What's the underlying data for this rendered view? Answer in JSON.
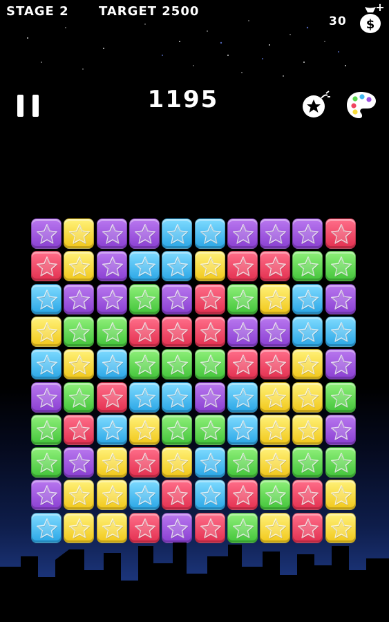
{
  "hud": {
    "stage_label": "STAGE 2",
    "target_label": "TARGET 2500",
    "score": "1195",
    "coins": "30",
    "moneybag_symbol": "$",
    "moneybag_plus": "+"
  },
  "icons": {
    "pause": "pause-icon",
    "bomb": "bomb-star-icon",
    "palette": "palette-icon",
    "moneybag": "money-bag-icon"
  },
  "colors": {
    "p": "#9b52e0",
    "y": "#f7dc3a",
    "b": "#41b8f0",
    "r": "#f0455f",
    "g": "#58d54c"
  },
  "board": {
    "rows": 10,
    "cols": 10,
    "grid": [
      "pyppbbpppr",
      "rypbbyrrgg",
      "bppgprgybp",
      "yggrrrppbb",
      "bybgggrryp",
      "pgrbbpbyyg",
      "grbyggbyyp",
      "gpyrybgygg",
      "pyybrbrgry",
      "byyrprgyry"
    ]
  }
}
